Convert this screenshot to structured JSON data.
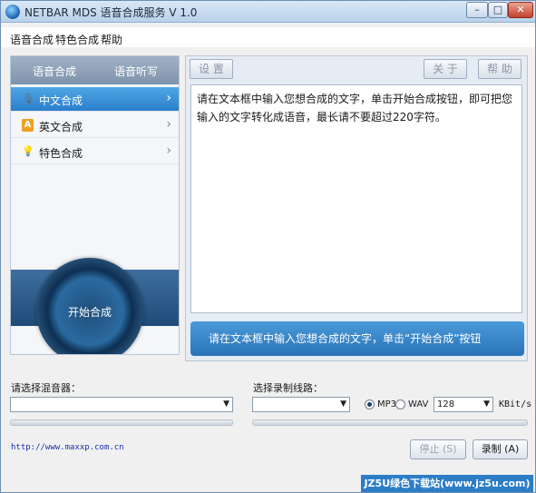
{
  "window": {
    "title": "NETBAR MDS 语音合成服务 V 1.0",
    "controls": {
      "minimize": "–",
      "maximize": "□",
      "close": "✕"
    }
  },
  "menu": [
    "语音合成",
    "特色合成",
    "帮助"
  ],
  "left_panel": {
    "tabs": [
      "语音合成",
      "语音听写"
    ],
    "items": [
      {
        "label": "中文合成",
        "icon": "microphone-icon",
        "glyph": "🎙",
        "chevron": "›"
      },
      {
        "label": "英文合成",
        "icon": "letter-a-icon",
        "glyph": "A",
        "chevron": "›"
      },
      {
        "label": "特色合成",
        "icon": "bulb-icon",
        "glyph": "💡",
        "chevron": "›"
      }
    ],
    "start_button": "开始合成"
  },
  "toolbar": {
    "settings": "设 置",
    "about": "关 于",
    "help": "帮 助"
  },
  "text_area": "请在文本框中输入您想合成的文字，单击开始合成按钮，即可把您输入的文字转化成语音，最长请不要超过220字符。",
  "hint": "请在文本框中输入您想合成的文字，单击“开始合成”按钮",
  "mixer": {
    "label": "请选择混音器：",
    "value": ""
  },
  "record": {
    "label": "选择录制线路：",
    "value": "",
    "formats": [
      "MP3",
      "WAV"
    ],
    "selected_format": "MP3",
    "bitrate": "128",
    "bitrate_unit": "KBit/s"
  },
  "link": "http://www.maxxp.com.cn",
  "buttons": {
    "stop": "停止 (S)",
    "record": "录制 (A)"
  },
  "watermark": "JZ5U绿色下载站(www.jz5u.com)",
  "colors": {
    "accent": "#2b7fcb",
    "hint_bar": "#3a87c9",
    "title_bar": "#c7dbf0"
  }
}
